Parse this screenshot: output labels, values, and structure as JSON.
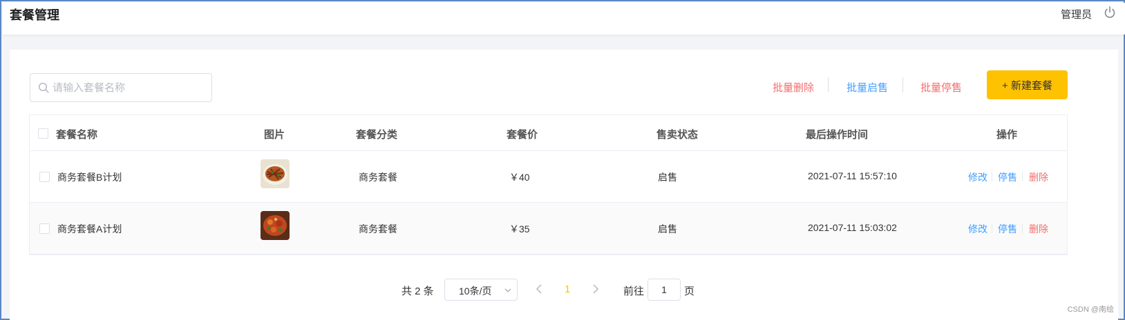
{
  "header": {
    "title": "套餐管理",
    "user": "管理员",
    "logout_icon": "power-icon"
  },
  "toolbar": {
    "search_placeholder": "请输入套餐名称",
    "search_value": "",
    "batch_delete": "批量删除",
    "batch_enable": "批量启售",
    "batch_disable": "批量停售",
    "create": "+ 新建套餐"
  },
  "table": {
    "headers": {
      "name": "套餐名称",
      "image": "图片",
      "category": "套餐分类",
      "price": "套餐价",
      "status": "售卖状态",
      "updated": "最后操作时间",
      "actions": "操作"
    },
    "rows": [
      {
        "name": "商务套餐B计划",
        "category": "商务套餐",
        "price": "￥40",
        "status": "启售",
        "updated": "2021-07-11 15:57:10",
        "edit": "修改",
        "toggle": "停售",
        "delete": "删除"
      },
      {
        "name": "商务套餐A计划",
        "category": "商务套餐",
        "price": "￥35",
        "status": "启售",
        "updated": "2021-07-11 15:03:02",
        "edit": "修改",
        "toggle": "停售",
        "delete": "删除"
      }
    ]
  },
  "pagination": {
    "total": "共 2 条",
    "page_size": "10条/页",
    "current_page": "1",
    "goto_label": "前往",
    "goto_value": "1",
    "goto_unit": "页"
  },
  "watermark": "CSDN @南绘",
  "colors": {
    "accent": "#ffc200",
    "link": "#409eff",
    "danger": "#f56c6c",
    "frame": "#5b86c4"
  }
}
